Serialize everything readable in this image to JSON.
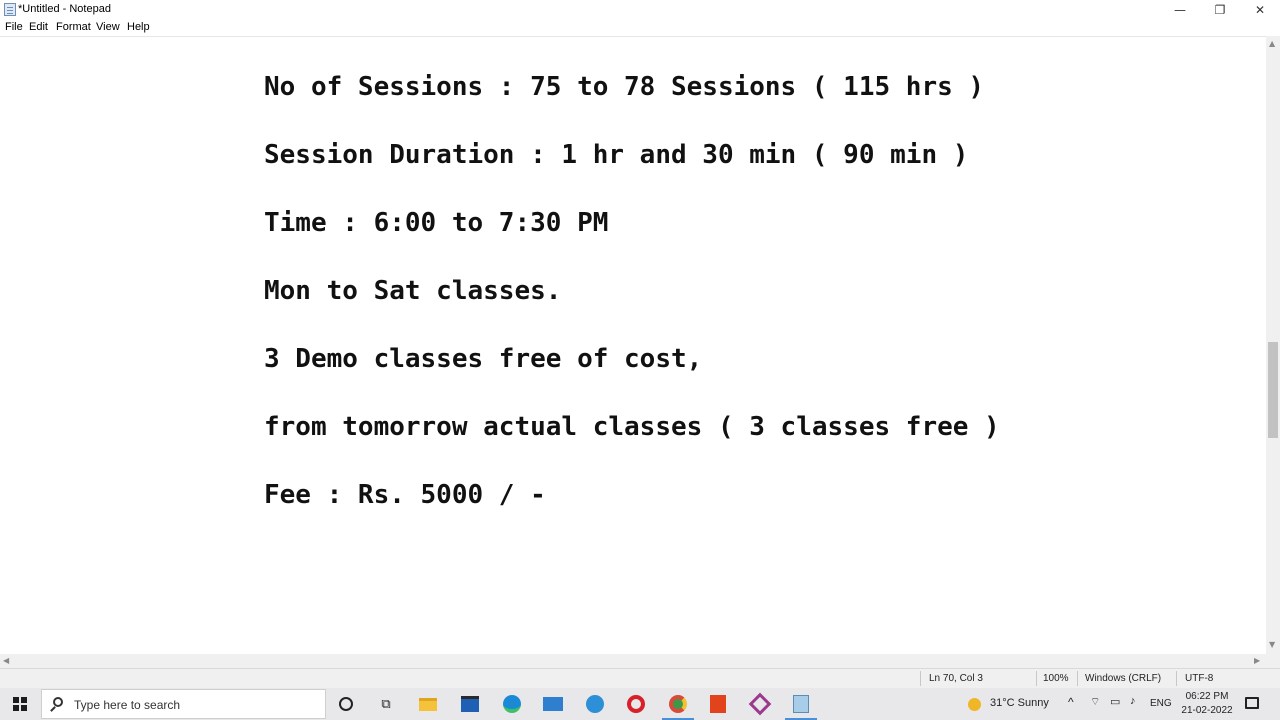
{
  "window": {
    "title": "*Untitled - Notepad",
    "minimize_glyph": "—",
    "restore_glyph": "❐",
    "close_glyph": "✕"
  },
  "menu": [
    "File",
    "Edit",
    "Format",
    "View",
    "Help"
  ],
  "document": {
    "lines": [
      "No of Sessions : 75 to 78 Sessions ( 115 hrs )",
      "Session Duration : 1 hr and 30 min ( 90 min )",
      "Time : 6:00 to 7:30 PM",
      "Mon to Sat classes.",
      "3 Demo classes free of cost,",
      "from tomorrow actual classes ( 3 classes free )",
      "Fee : Rs. 5000 / -"
    ]
  },
  "statusbar": {
    "position": "Ln 70, Col 3",
    "zoom": "100%",
    "line_ending": "Windows (CRLF)",
    "encoding": "UTF-8"
  },
  "taskbar": {
    "search_placeholder": "Type here to search",
    "icons": [
      "cortana-icon",
      "task-view-icon",
      "file-explorer-icon",
      "store-icon",
      "edge-icon",
      "mail-icon",
      "maps-icon",
      "opera-icon",
      "chrome-icon",
      "office-icon",
      "snipping-tool-icon",
      "notepad-icon"
    ],
    "weather": "31°C  Sunny",
    "language": "ENG",
    "time": "06:22 PM",
    "date": "21-02-2022"
  },
  "colors": {
    "accent": "#4a90d9",
    "text": "#111111",
    "taskbar": "#e8e8ea"
  }
}
